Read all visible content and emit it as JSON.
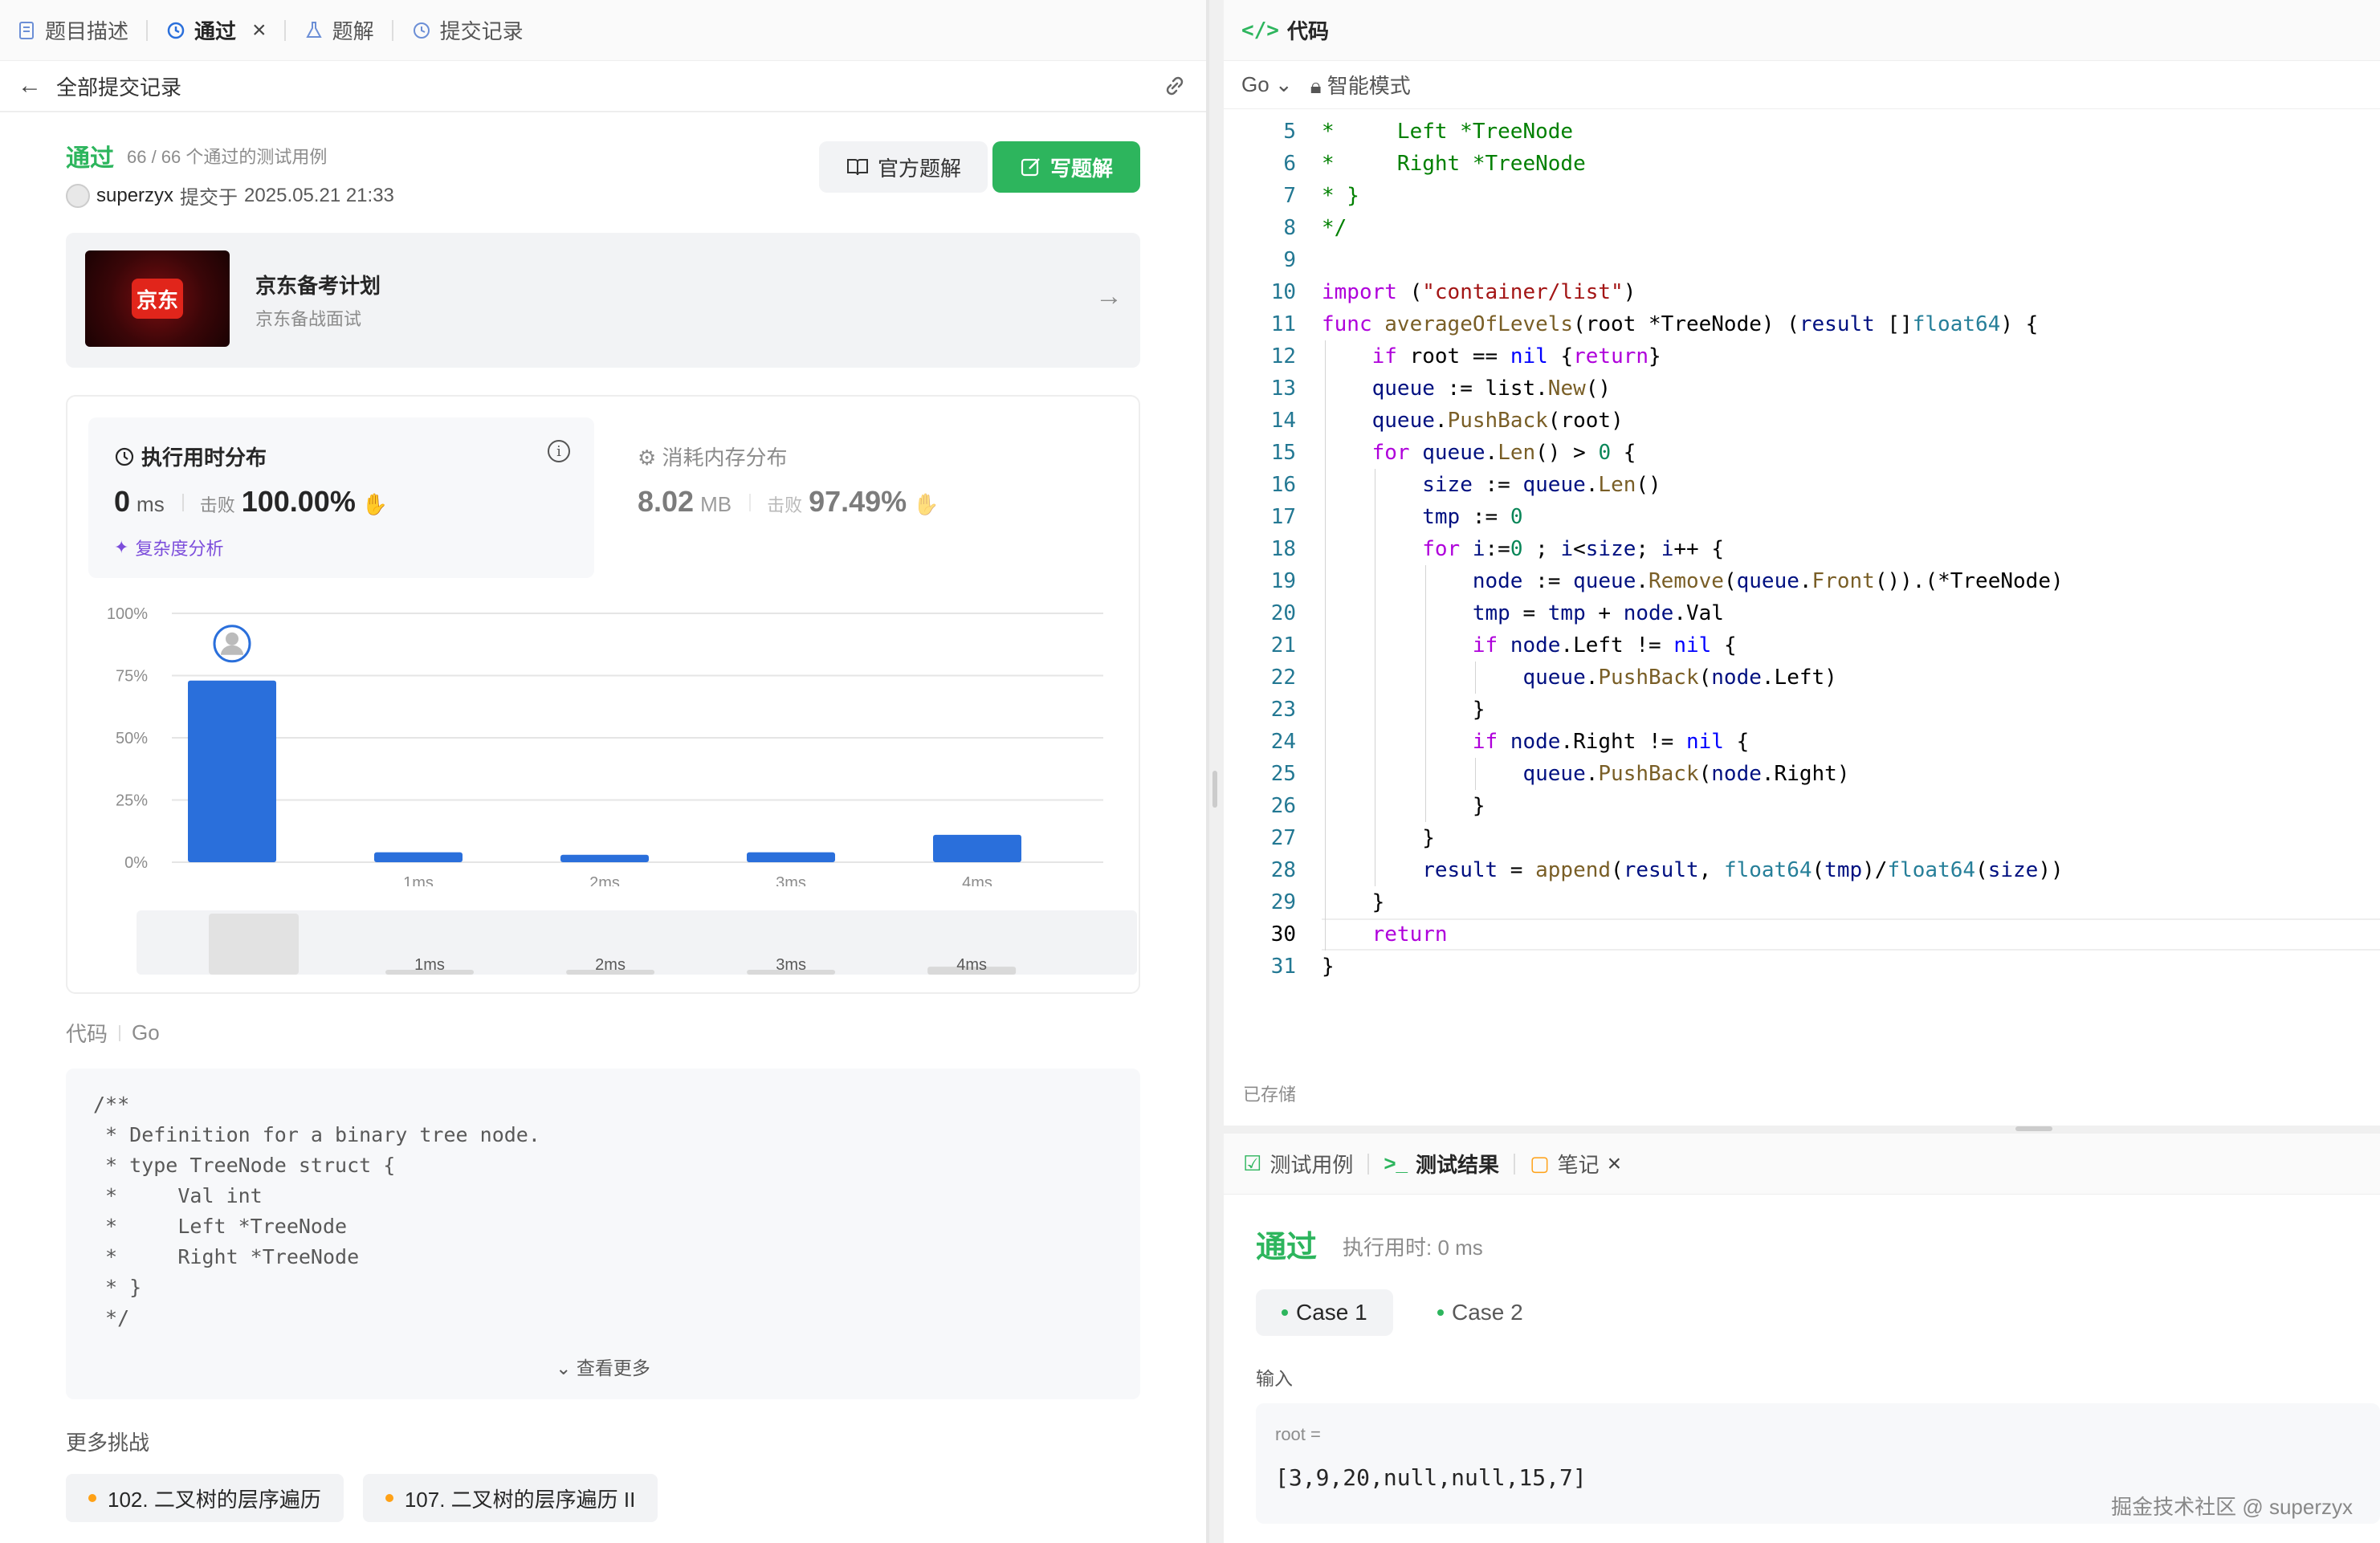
{
  "left_tabs": [
    {
      "label": "题目描述",
      "icon": "doc-icon"
    },
    {
      "label": "通过",
      "icon": "history-icon",
      "active": true
    },
    {
      "label": "题解",
      "icon": "flask-icon"
    },
    {
      "label": "提交记录",
      "icon": "history-icon"
    }
  ],
  "subbar": {
    "back_label": "全部提交记录"
  },
  "result": {
    "status": "通过",
    "passed_cases": "66 / 66 个通过的测试用例",
    "user": "superzyx",
    "submitted_prefix": "提交于",
    "submitted_at": "2025.05.21 21:33",
    "official_btn": "官方题解",
    "write_btn": "写题解"
  },
  "promo": {
    "title": "京东备考计划",
    "subtitle": "京东备战面试",
    "logo_text": "京东"
  },
  "runtime": {
    "title": "执行用时分布",
    "value": "0",
    "unit": "ms",
    "beat_label": "击败",
    "beat_pct": "100.00%",
    "complexity": "复杂度分析"
  },
  "memory": {
    "title": "消耗内存分布",
    "value": "8.02",
    "unit": "MB",
    "beat_label": "击败",
    "beat_pct": "97.49%"
  },
  "chart_data": {
    "type": "bar",
    "categories": [
      "0ms",
      "1ms",
      "2ms",
      "3ms",
      "4ms"
    ],
    "x_tick_labels": [
      "",
      "1ms",
      "2ms",
      "3ms",
      "4ms"
    ],
    "values": [
      73,
      4,
      3,
      4,
      11
    ],
    "ylim": [
      0,
      100
    ],
    "y_ticks": [
      "100%",
      "75%",
      "50%",
      "25%",
      "0%"
    ],
    "highlight_index": 0,
    "bar_color": "#2a6fdb",
    "overview_labels": [
      "1ms",
      "2ms",
      "3ms",
      "4ms"
    ]
  },
  "code_section": {
    "label": "代码",
    "lang": "Go",
    "see_more": "查看更多"
  },
  "code_preview": "/**\n * Definition for a binary tree node.\n * type TreeNode struct {\n *     Val int\n *     Left *TreeNode\n *     Right *TreeNode\n * }\n */",
  "more": {
    "title": "更多挑战",
    "items": [
      "102. 二叉树的层序遍历",
      "107. 二叉树的层序遍历 II"
    ]
  },
  "editor": {
    "tab_label": "代码",
    "lang": "Go",
    "mode": "智能模式",
    "saved": "已存储",
    "current_line": 30,
    "lines": [
      {
        "n": 5,
        "text": "*     Left *TreeNode"
      },
      {
        "n": 6,
        "text": "*     Right *TreeNode"
      },
      {
        "n": 7,
        "text": "* }"
      },
      {
        "n": 8,
        "text": "*/"
      },
      {
        "n": 9,
        "text": ""
      },
      {
        "n": 10,
        "text": "import (\"container/list\")"
      },
      {
        "n": 11,
        "text": "func averageOfLevels(root *TreeNode) (result []float64) {"
      },
      {
        "n": 12,
        "text": "    if root == nil {return}"
      },
      {
        "n": 13,
        "text": "    queue := list.New()"
      },
      {
        "n": 14,
        "text": "    queue.PushBack(root)"
      },
      {
        "n": 15,
        "text": "    for queue.Len() > 0 {"
      },
      {
        "n": 16,
        "text": "        size := queue.Len()"
      },
      {
        "n": 17,
        "text": "        tmp := 0"
      },
      {
        "n": 18,
        "text": "        for i:=0 ; i<size; i++ {"
      },
      {
        "n": 19,
        "text": "            node := queue.Remove(queue.Front()).(*TreeNode)"
      },
      {
        "n": 20,
        "text": "            tmp = tmp + node.Val"
      },
      {
        "n": 21,
        "text": "            if node.Left != nil {"
      },
      {
        "n": 22,
        "text": "                queue.PushBack(node.Left)"
      },
      {
        "n": 23,
        "text": "            }"
      },
      {
        "n": 24,
        "text": "            if node.Right != nil {"
      },
      {
        "n": 25,
        "text": "                queue.PushBack(node.Right)"
      },
      {
        "n": 26,
        "text": "            }"
      },
      {
        "n": 27,
        "text": "        }"
      },
      {
        "n": 28,
        "text": "        result = append(result, float64(tmp)/float64(size))"
      },
      {
        "n": 29,
        "text": "    }"
      },
      {
        "n": 30,
        "text": "    return"
      },
      {
        "n": 31,
        "text": "}"
      }
    ]
  },
  "results": {
    "tabs": [
      "测试用例",
      "测试结果",
      "笔记"
    ],
    "status": "通过",
    "runtime": "执行用时: 0 ms",
    "cases": [
      "Case 1",
      "Case 2"
    ],
    "input_label": "输入",
    "input_var": "root =",
    "input_value": "[3,9,20,null,null,15,7]"
  },
  "watermark": "掘金技术社区 @ superzyx",
  "colors": {
    "accent_green": "#2db55d",
    "bar_blue": "#2a6fdb"
  }
}
